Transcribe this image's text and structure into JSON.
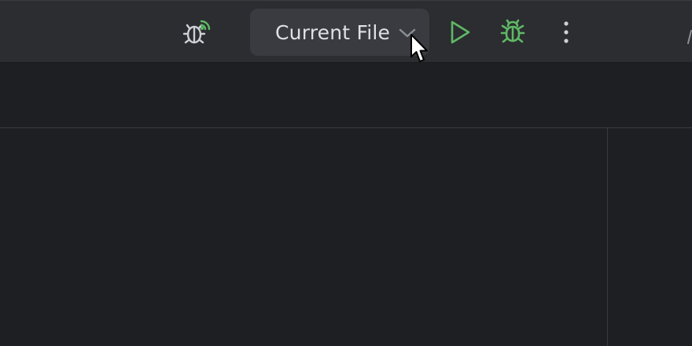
{
  "toolbar": {
    "run_configuration": {
      "label": "Current File",
      "dropdown_icon": "chevron-down-icon"
    },
    "icons": {
      "remote_debug": "bug-remote-icon",
      "run": "play-icon",
      "debug": "bug-icon",
      "more": "more-vertical-icon"
    },
    "colors": {
      "run_green": "#5fb865",
      "icon_gray": "#ced0d6"
    }
  }
}
